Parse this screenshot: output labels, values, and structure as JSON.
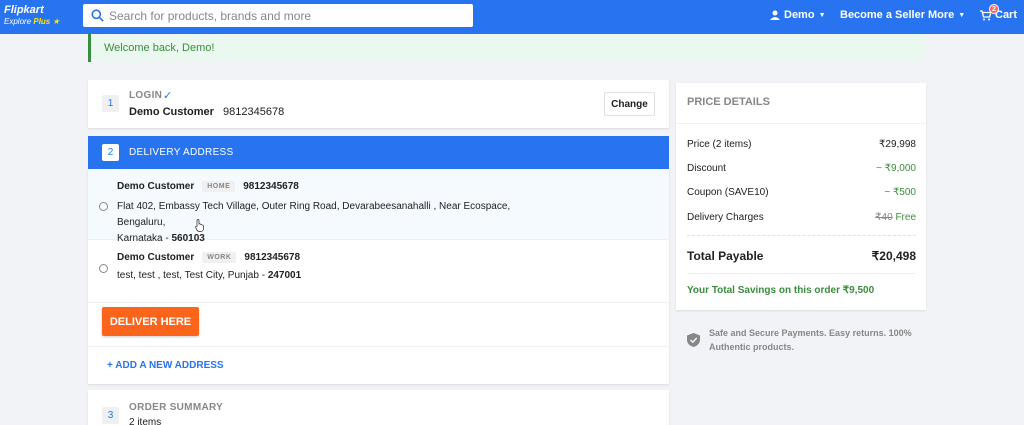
{
  "header": {
    "logo_main": "Flipkart",
    "logo_sub": "Explore",
    "logo_plus": "Plus",
    "search_placeholder": "Search for products, brands and more",
    "user_label": "Demo",
    "seller_label": "Become a Seller",
    "more_label": "More",
    "cart_label": "Cart",
    "cart_count": "2",
    "brand_color": "#2874f0"
  },
  "welcome": "Welcome back, Demo!",
  "login": {
    "step": "1",
    "title": "LOGIN",
    "name": "Demo Customer",
    "phone": "9812345678",
    "change_label": "Change"
  },
  "delivery": {
    "step": "2",
    "title": "DELIVERY ADDRESS",
    "addresses": [
      {
        "name": "Demo Customer",
        "tag": "HOME",
        "phone": "9812345678",
        "line1": "Flat 402, Embassy Tech Village, Outer Ring Road, Devarabeesanahalli , Near Ecospace, Bengaluru,",
        "line2": "Karnataka - ",
        "pin": "560103"
      },
      {
        "name": "Demo Customer",
        "tag": "WORK",
        "phone": "9812345678",
        "line1": "test, test , test, Test City, Punjab - ",
        "pin": "247001"
      }
    ],
    "deliver_label": "DELIVER HERE",
    "add_address_label": "+ ADD A NEW ADDRESS"
  },
  "summary": {
    "step": "3",
    "title": "ORDER SUMMARY",
    "sub": "2 items"
  },
  "price": {
    "title": "PRICE DETAILS",
    "rows": [
      {
        "label": "Price (2 items)",
        "value": "₹29,998"
      },
      {
        "label": "Discount",
        "value": "− ₹9,000"
      },
      {
        "label": "Coupon (SAVE10)",
        "value": "− ₹500"
      },
      {
        "label": "Delivery Charges",
        "value_strike": "₹40",
        "value": "Free"
      }
    ],
    "total_label": "Total Payable",
    "total_value": "₹20,498",
    "savings": "Your Total Savings on this order ₹9,500"
  },
  "secure_text": "Safe and Secure Payments. Easy returns. 100% Authentic products."
}
